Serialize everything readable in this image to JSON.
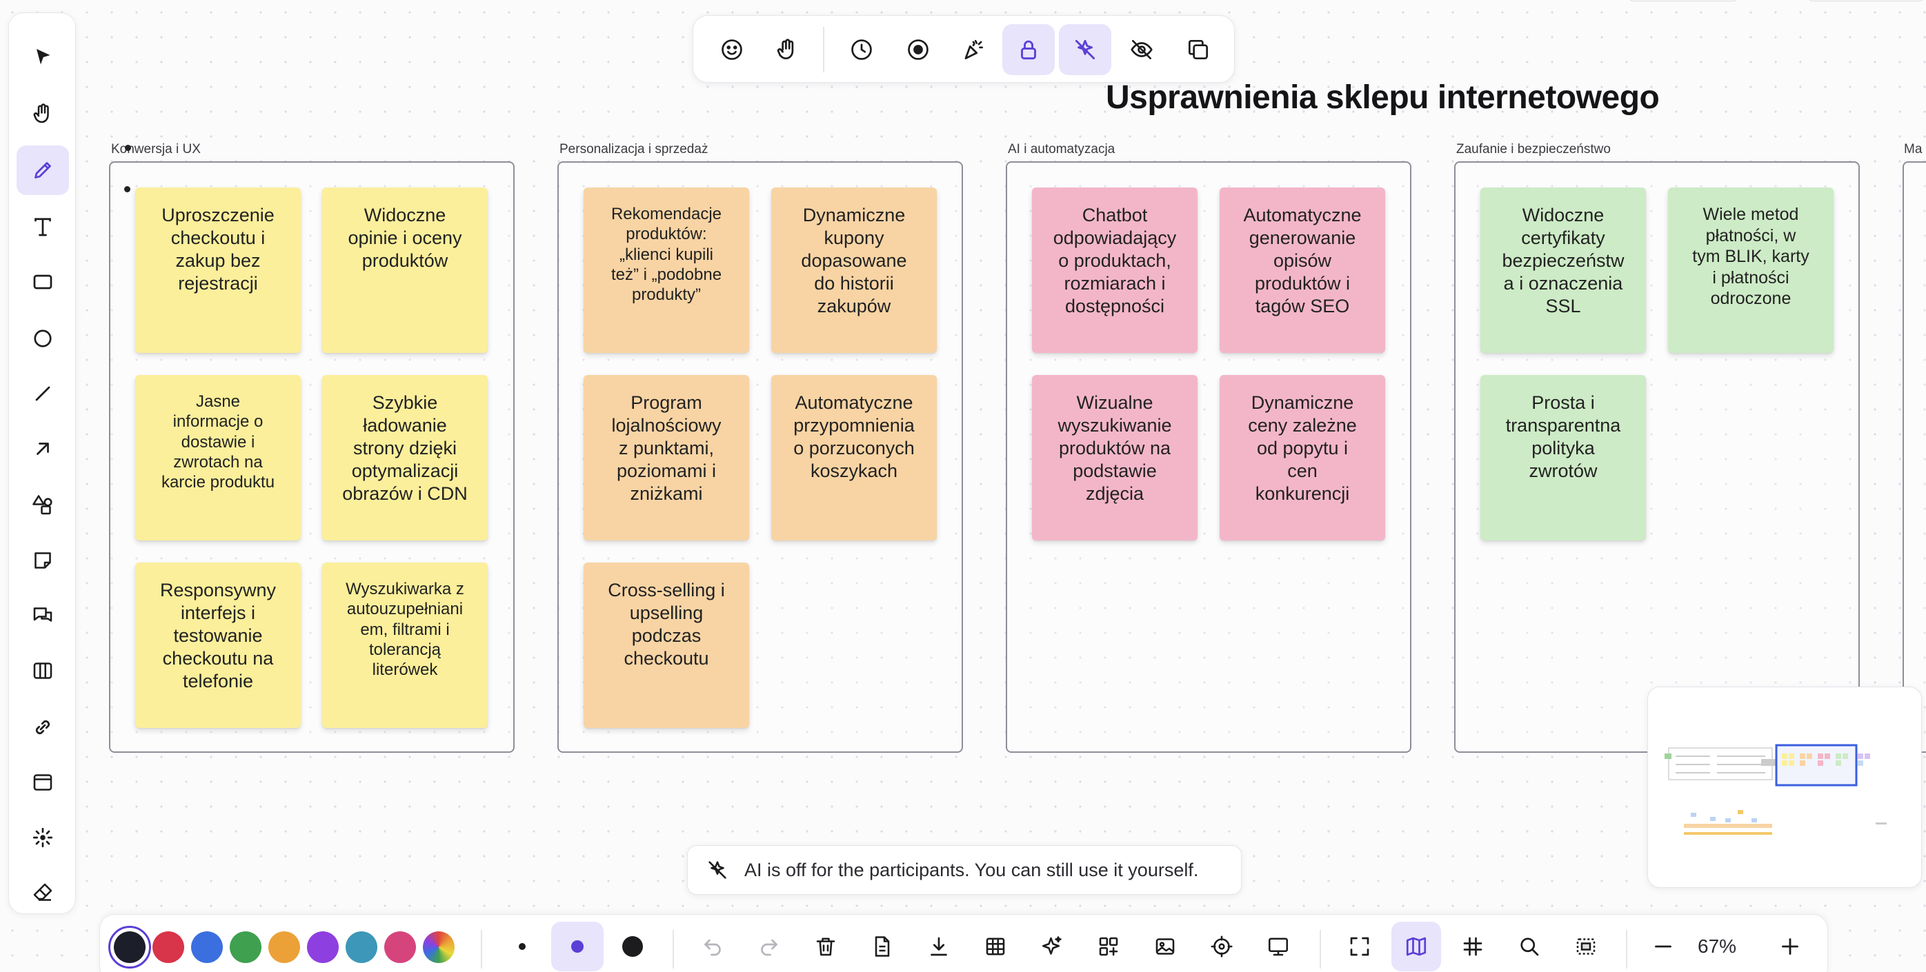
{
  "board": {
    "title": "Usprawnienia sklepu internetowego",
    "frames": [
      {
        "label": "Konwersja i UX",
        "color": "#fbef9b",
        "notes": [
          "Uproszczenie\ncheckoutu i\nzakup bez\nrejestracji",
          "Widoczne\nopinie i oceny\nproduktów",
          "Jasne\ninformacje o\ndostawie i\nzwrotach na\nkarcie produktu",
          "Szybkie\nładowanie\nstrony dzięki\noptymalizacji\nobrazów i CDN",
          "Responsywny\ninterfejs i\ntestowanie\ncheckoutu na\ntelefonie",
          "Wyszukiwarka z\nautouzupełniani\nem, filtrami i\ntolerancją\nliterówek"
        ]
      },
      {
        "label": "Personalizacja i sprzedaż",
        "color": "#f8d4a4",
        "notes": [
          "Rekomendacje\nproduktów:\n„klienci kupili\nteż” i „podobne\nprodukty”",
          "Dynamiczne\nkupony\ndopasowane\ndo historii\nzakupów",
          "Program\nlojalnościowy\nz punktami,\npoziomami i\nzniżkami",
          "Automatyczne\nprzypomnienia\no porzuconych\nkoszykach",
          "Cross-selling i\nupselling\npodczas\ncheckoutu"
        ]
      },
      {
        "label": "AI i automatyzacja",
        "color": "#f3b6c9",
        "notes": [
          "Chatbot\nodpowiadający\no produktach,\nrozmiarach i\ndostępności",
          "Automatyczne\ngenerowanie\nopisów\nproduktów i\ntagów SEO",
          "Wizualne\nwyszukiwanie\nproduktów na\npodstawie\nzdjęcia",
          "Dynamiczne\nceny zależne\nod popytu i\ncen\nkonkurencji"
        ]
      },
      {
        "label": "Zaufanie i bezpieczeństwo",
        "color": "#cdebc6",
        "notes": [
          "Widoczne\ncertyfikaty\nbezpieczeństw\na i oznaczenia\nSSL",
          "Wiele metod\npłatności, w\ntym BLIK, karty\ni płatności\nodroczone",
          "Prosta i\ntransparentna\npolityka\nzwrotów"
        ]
      },
      {
        "label": "Ma"
      }
    ]
  },
  "toast": {
    "message": "AI is off for the participants. You can still use it yourself."
  },
  "left_toolbar": {
    "icons": [
      "select-icon",
      "hand-icon",
      "pencil-icon",
      "text-icon",
      "rectangle-icon",
      "ellipse-icon",
      "line-icon",
      "arrow-icon",
      "shapes-icon",
      "sticky-note-icon",
      "comment-icon",
      "table-icon",
      "link-icon",
      "frame-icon",
      "laser-icon",
      "eraser-icon"
    ],
    "active": "pencil-icon"
  },
  "top_toolbar": {
    "icons": [
      "emoji-icon",
      "hand-raise-icon",
      "timer-icon",
      "record-icon",
      "celebrate-icon",
      "lock-icon",
      "ai-off-icon",
      "hide-icon",
      "duplicate-icon"
    ],
    "active": [
      "lock-icon",
      "ai-off-icon"
    ]
  },
  "bottom_toolbar": {
    "colors": [
      "#1c1f2a",
      "#d8344a",
      "#3b6fe0",
      "#3fa050",
      "#eba138",
      "#8e3fe0",
      "#3d97b8",
      "#d6447c"
    ],
    "selected_color": "#1c1f2a",
    "stroke_sizes": [
      "small",
      "medium",
      "large"
    ],
    "selected_stroke": "medium",
    "zoom": "67%"
  },
  "minimap": {
    "present": true
  }
}
